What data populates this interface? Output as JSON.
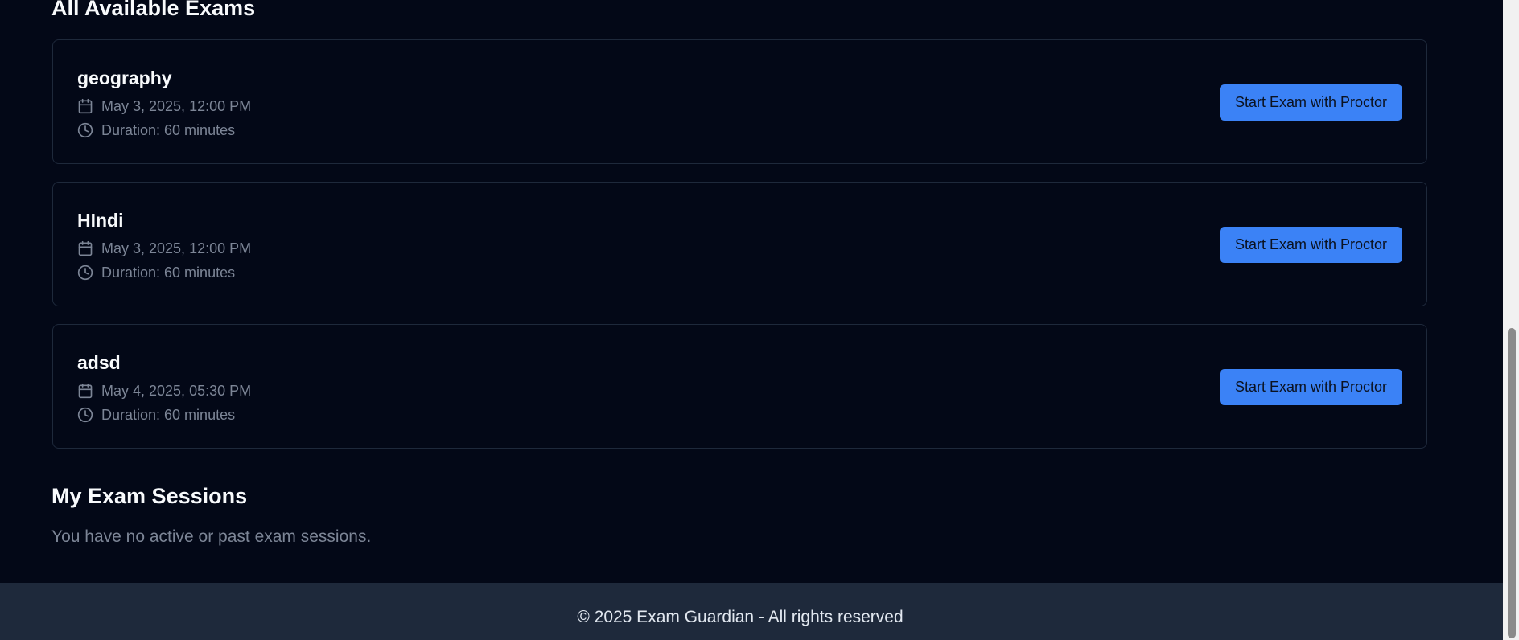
{
  "sections": {
    "available_title": "All Available Exams",
    "sessions_title": "My Exam Sessions",
    "sessions_empty": "You have no active or past exam sessions."
  },
  "exams": [
    {
      "name": "geography",
      "date": "May 3, 2025, 12:00 PM",
      "duration": "Duration: 60 minutes",
      "button_label": "Start Exam with Proctor"
    },
    {
      "name": "HIndi",
      "date": "May 3, 2025, 12:00 PM",
      "duration": "Duration: 60 minutes",
      "button_label": "Start Exam with Proctor"
    },
    {
      "name": "adsd",
      "date": "May 4, 2025, 05:30 PM",
      "duration": "Duration: 60 minutes",
      "button_label": "Start Exam with Proctor"
    }
  ],
  "footer": {
    "text": "© 2025 Exam Guardian - All rights reserved"
  },
  "icons": {
    "date": "calendar-icon",
    "duration": "clock-icon"
  },
  "colors": {
    "background": "#030817",
    "card_border": "#1e293b",
    "accent": "#3b82f6",
    "muted_text": "#7c8596",
    "footer_bg": "#1e293b"
  }
}
